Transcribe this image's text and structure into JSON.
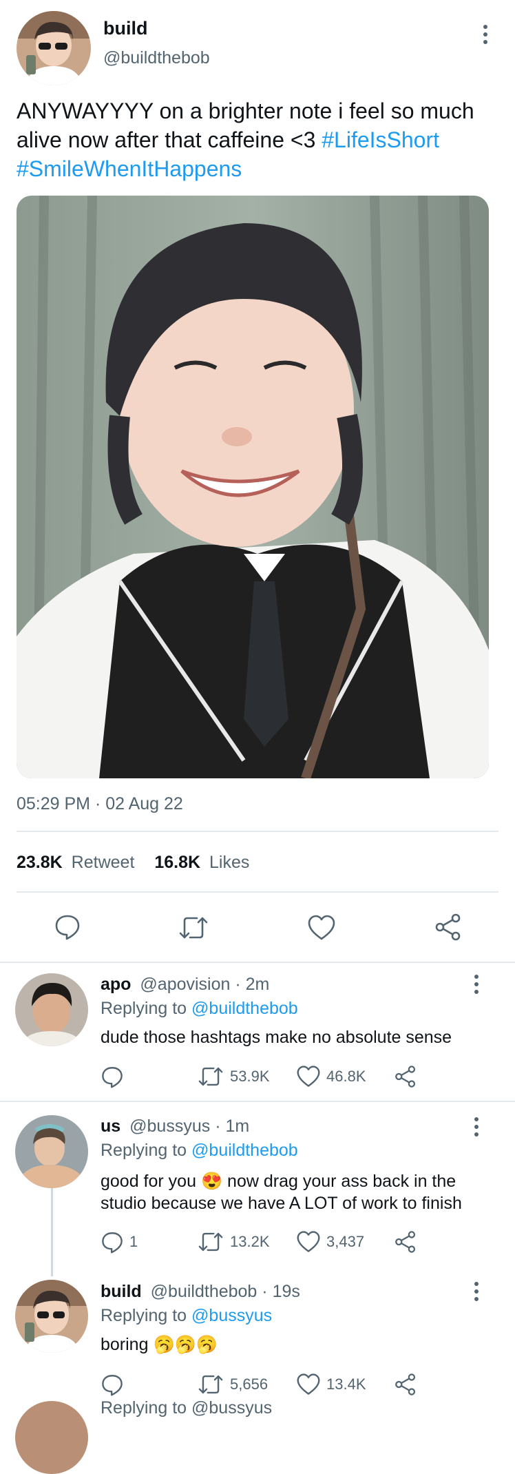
{
  "tweet": {
    "author_name": "build",
    "author_handle": "@buildthebob",
    "text_main": "ANYWAYYYY on a brighter note i feel so much alive now after that caffeine <3",
    "hashtag1": "#LifeIsShort",
    "hashtag2": "#SmileWhenItHappens",
    "timestamp": "05:29 PM · 02 Aug 22",
    "retweet_count": "23.8K",
    "retweet_label": "Retweet",
    "likes_count": "16.8K",
    "likes_label": "Likes"
  },
  "replies": [
    {
      "name": "apo",
      "handle": "@apovision",
      "time": "· 2m",
      "replying_label": "Replying to",
      "replying_to": "@buildthebob",
      "text": "dude those hashtags make no absolute sense",
      "reply_count": "",
      "retweets": "53.9K",
      "likes": "46.8K"
    },
    {
      "name": "us",
      "handle": "@bussyus",
      "time": "· 1m",
      "replying_label": "Replying to",
      "replying_to": "@buildthebob",
      "text_line1_a": "good for you",
      "text_line1_emoji": "😍",
      "text_line1_b": "now drag your ass back in the",
      "text_line2": "studio because we have A LOT of work to finish",
      "reply_count": "1",
      "retweets": "13.2K",
      "likes": "3,437"
    },
    {
      "name": "build",
      "handle": "@buildthebob",
      "time": "· 19s",
      "replying_label": "Replying to",
      "replying_to": "@bussyus",
      "text": "boring",
      "emojis": "🥱🥱🥱",
      "reply_count": "",
      "retweets": "5,656",
      "likes": "13.4K"
    }
  ],
  "cutoff_text": "Replying to @bussyus",
  "icons": {
    "reply": "reply-icon",
    "retweet": "retweet-icon",
    "like": "heart-icon",
    "share": "share-icon",
    "more": "more-options-icon"
  },
  "colors": {
    "accent": "#1d9bf0",
    "muted": "#536471",
    "text": "#0f1419",
    "divider": "#e6e9ec"
  }
}
